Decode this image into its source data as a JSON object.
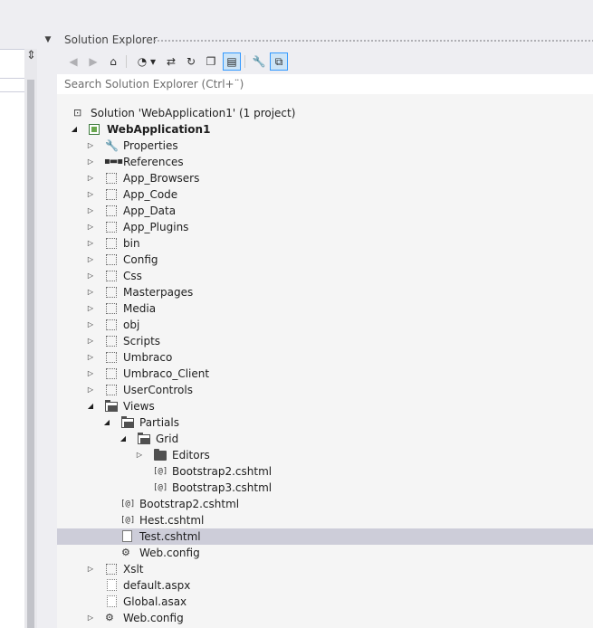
{
  "panel": {
    "title": "Solution Explorer"
  },
  "toolbar": {
    "buttons": [
      {
        "icon": "back-icon",
        "glyph": "◀"
      },
      {
        "icon": "forward-icon",
        "glyph": "▶"
      },
      {
        "icon": "home-icon",
        "glyph": "⌂"
      },
      {
        "icon": "pending-changes-icon",
        "glyph": "◔"
      },
      {
        "icon": "dropdown-arrow-icon",
        "glyph": "▾"
      },
      {
        "icon": "sync-icon",
        "glyph": "⇄"
      },
      {
        "icon": "refresh-icon",
        "glyph": "↻"
      },
      {
        "icon": "collapse-all-icon",
        "glyph": "❐"
      },
      {
        "icon": "show-all-files-icon",
        "glyph": "▤"
      },
      {
        "icon": "properties-icon",
        "glyph": "🔧"
      },
      {
        "icon": "preview-icon",
        "glyph": "⧉"
      }
    ]
  },
  "search": {
    "placeholder": "Search Solution Explorer (Ctrl+¨)"
  },
  "tree": {
    "solution": "Solution 'WebApplication1' (1 project)",
    "project": "WebApplication1",
    "items": [
      {
        "label": "Properties",
        "icon": "wrench-icon"
      },
      {
        "label": "References",
        "icon": "references-icon"
      },
      {
        "label": "App_Browsers",
        "icon": "dashed-folder-icon"
      },
      {
        "label": "App_Code",
        "icon": "dashed-folder-icon"
      },
      {
        "label": "App_Data",
        "icon": "dashed-folder-icon"
      },
      {
        "label": "App_Plugins",
        "icon": "dashed-folder-icon"
      },
      {
        "label": "bin",
        "icon": "dashed-folder-icon"
      },
      {
        "label": "Config",
        "icon": "dashed-folder-icon"
      },
      {
        "label": "Css",
        "icon": "dashed-folder-icon"
      },
      {
        "label": "Masterpages",
        "icon": "dashed-folder-icon"
      },
      {
        "label": "Media",
        "icon": "dashed-folder-icon"
      },
      {
        "label": "obj",
        "icon": "dashed-folder-icon"
      },
      {
        "label": "Scripts",
        "icon": "dashed-folder-icon"
      },
      {
        "label": "Umbraco",
        "icon": "dashed-folder-icon"
      },
      {
        "label": "Umbraco_Client",
        "icon": "dashed-folder-icon"
      },
      {
        "label": "UserControls",
        "icon": "dashed-folder-icon"
      },
      {
        "label": "Views",
        "icon": "open-folder-icon"
      },
      {
        "label": "Partials",
        "icon": "open-folder-icon"
      },
      {
        "label": "Grid",
        "icon": "open-folder-icon"
      },
      {
        "label": "Editors",
        "icon": "folder-icon"
      },
      {
        "label": "Bootstrap2.cshtml",
        "icon": "cshtml-file-icon"
      },
      {
        "label": "Bootstrap3.cshtml",
        "icon": "cshtml-file-icon"
      },
      {
        "label": "Bootstrap2.cshtml",
        "icon": "cshtml-file-icon"
      },
      {
        "label": "Hest.cshtml",
        "icon": "cshtml-file-icon"
      },
      {
        "label": "Test.cshtml",
        "icon": "file-icon"
      },
      {
        "label": "Web.config",
        "icon": "config-file-icon"
      },
      {
        "label": "Xslt",
        "icon": "dashed-folder-icon"
      },
      {
        "label": "default.aspx",
        "icon": "dashed-file-icon"
      },
      {
        "label": "Global.asax",
        "icon": "dashed-file-icon"
      },
      {
        "label": "Web.config",
        "icon": "config-file-icon"
      }
    ]
  },
  "colors": {
    "selection": "#cdcdd9",
    "chrome": "#eeeef2",
    "tree_bg": "#f5f5f5",
    "pressed_border": "#3399ff"
  }
}
